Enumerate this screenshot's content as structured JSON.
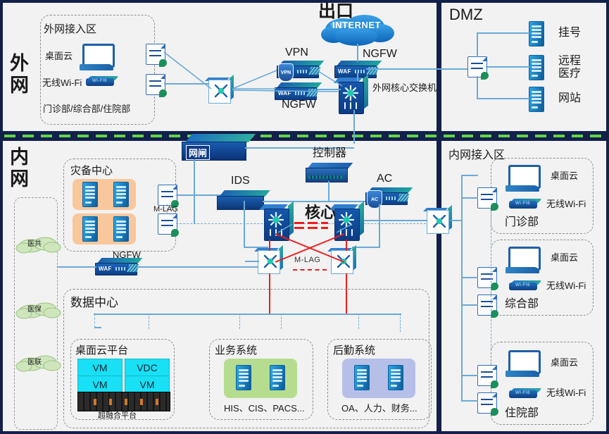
{
  "zones": {
    "external": {
      "label": "外网"
    },
    "internal": {
      "label": "内网"
    },
    "dmz": {
      "label": "DMZ"
    },
    "egress": {
      "label": "出口"
    }
  },
  "external_access": {
    "title": "外网接入区",
    "desktop_cloud": "桌面云",
    "wifi": "无线Wi-Fi",
    "footer": "门诊部/综合部/住院部"
  },
  "egress_area": {
    "internet": "INTERNET",
    "vpn": "VPN",
    "ngfw_top": "NGFW",
    "ngfw_left": "NGFW",
    "waf_tag": "WAF",
    "vpn_tag": "VPN",
    "core_switch": "外网核心交换机"
  },
  "dmz": {
    "title": "DMZ",
    "servers": [
      {
        "label": "挂号"
      },
      {
        "label": "远程医疗"
      },
      {
        "label": "网站"
      }
    ]
  },
  "gatekeeper": {
    "label": "网闸"
  },
  "internal_core": {
    "controller": "控制器",
    "ids": "IDS",
    "ac": "AC",
    "core": "核心",
    "mlag": "M-LAG",
    "ac_tag": "AC"
  },
  "dr_center": {
    "title": "灾备中心",
    "mlag": "M-LAG"
  },
  "dr_ngfw": {
    "label": "NGFW",
    "tag": "WAF"
  },
  "ext_clouds": [
    {
      "label": "医共"
    },
    {
      "label": "医保"
    },
    {
      "label": "医联"
    }
  ],
  "data_center": {
    "title": "数据中心",
    "groups": [
      {
        "title": "桌面云平台",
        "vms": [
          "VM",
          "VDC",
          "VM",
          "VM"
        ],
        "footer": "超融合平台"
      },
      {
        "title": "业务系统",
        "footer": "HIS、CIS、PACS..."
      },
      {
        "title": "后勤系统",
        "footer": "OA、人力、财务..."
      }
    ]
  },
  "internal_access": {
    "title": "内网接入区",
    "departments": [
      {
        "name": "门诊部",
        "desktop_cloud": "桌面云",
        "wifi": "无线Wi-Fi"
      },
      {
        "name": "综合部",
        "desktop_cloud": "桌面云",
        "wifi": "无线Wi-Fi"
      },
      {
        "name": "住院部",
        "desktop_cloud": "桌面云",
        "wifi": "无线Wi-Fi"
      }
    ]
  },
  "colors": {
    "border_navy": "#12204a",
    "divider_green": "#63d447",
    "link_blue": "#6aa9d8",
    "link_red": "#f01c1c",
    "panel_bg": "#f2f2f2"
  }
}
